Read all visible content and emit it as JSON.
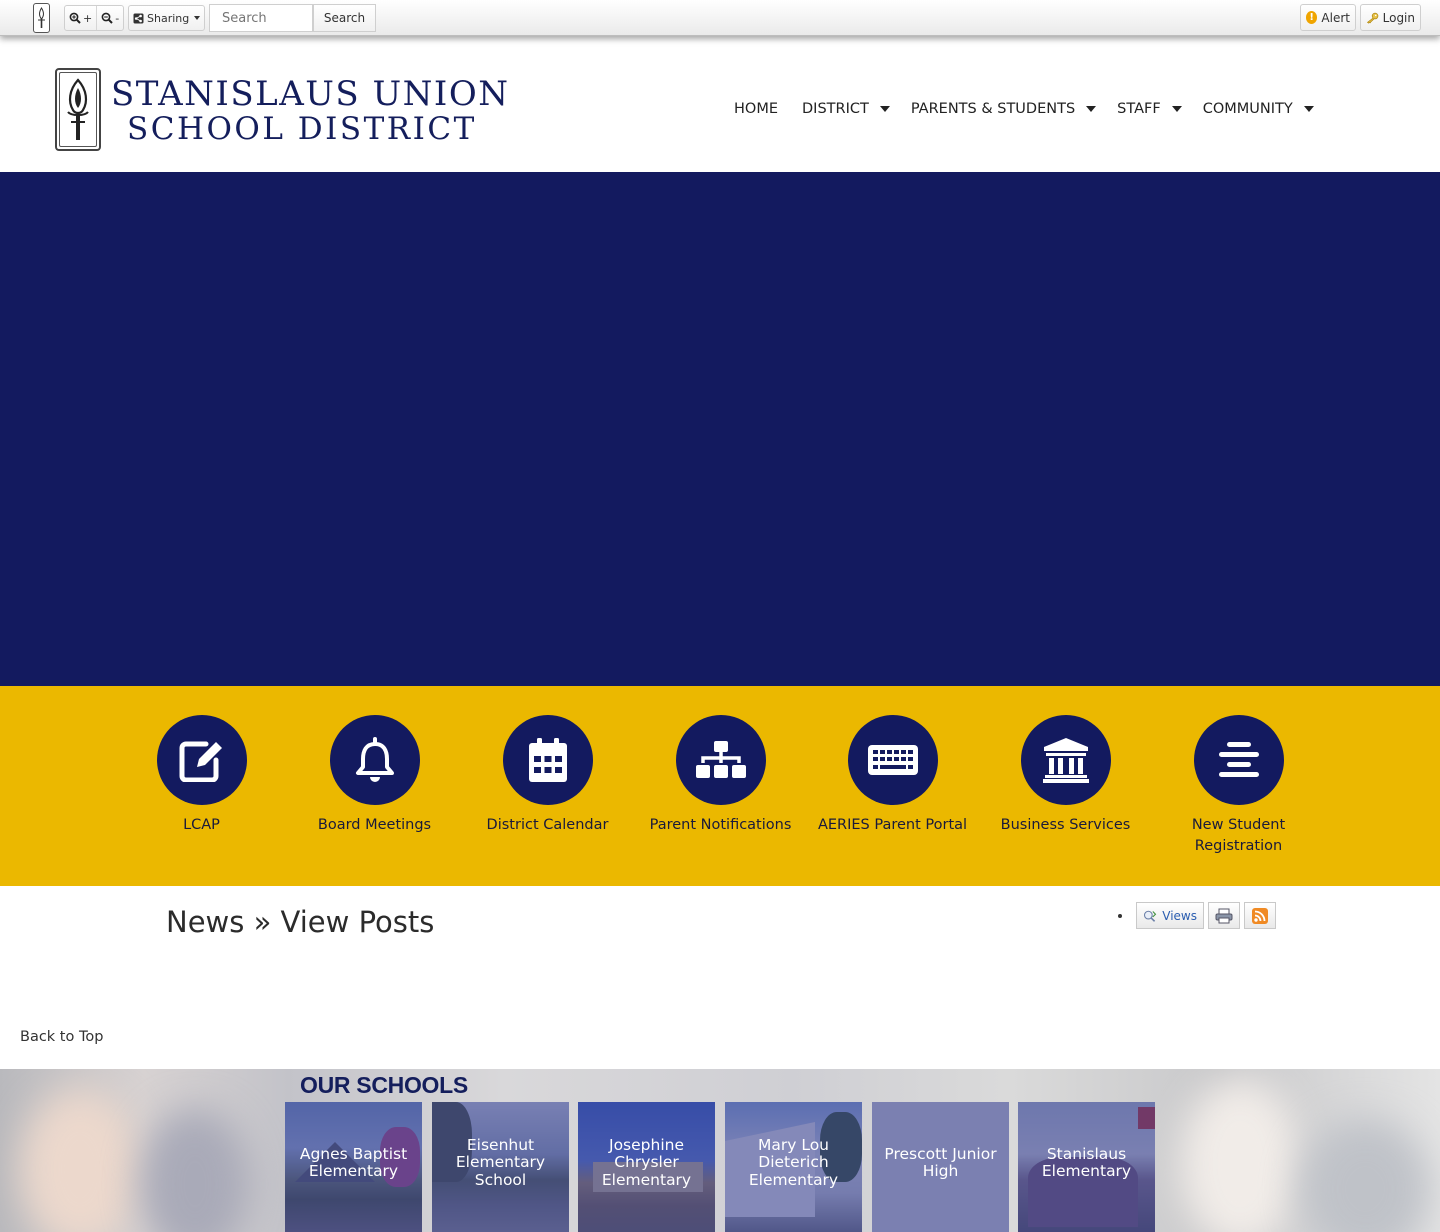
{
  "toolbar": {
    "zoom_in_label": "+",
    "zoom_out_label": "-",
    "sharing_label": "Sharing",
    "search_placeholder": "Search",
    "search_button": "Search",
    "alert_label": "Alert",
    "login_label": "Login"
  },
  "header": {
    "logo_line1": "STANISLAUS UNION",
    "logo_line2": "SCHOOL DISTRICT",
    "nav": [
      {
        "label": "HOME",
        "dropdown": false
      },
      {
        "label": "DISTRICT",
        "dropdown": true
      },
      {
        "label": "PARENTS & STUDENTS",
        "dropdown": true
      },
      {
        "label": "STAFF",
        "dropdown": true
      },
      {
        "label": "COMMUNITY",
        "dropdown": true
      }
    ]
  },
  "colors": {
    "navy": "#131a5f",
    "gold": "#ebb800",
    "logo_text": "#141e5c"
  },
  "quick_links": [
    {
      "label": "LCAP",
      "icon": "edit-icon"
    },
    {
      "label": "Board Meetings",
      "icon": "bell-icon"
    },
    {
      "label": "District Calendar",
      "icon": "calendar-icon"
    },
    {
      "label": "Parent Notifications",
      "icon": "sitemap-icon"
    },
    {
      "label": "AERIES Parent Portal",
      "icon": "keyboard-icon"
    },
    {
      "label": "Business Services",
      "icon": "institution-icon"
    },
    {
      "label": "New Student Registration",
      "icon": "align-center-icon"
    }
  ],
  "content": {
    "page_title": "News » View Posts",
    "views_label": "Views",
    "back_to_top": "Back to Top"
  },
  "schools": {
    "title": "OUR SCHOOLS",
    "items": [
      {
        "name": "Agnes Baptist Elementary"
      },
      {
        "name": "Eisenhut Elementary School"
      },
      {
        "name": "Josephine Chrysler Elementary"
      },
      {
        "name": "Mary Lou Dieterich Elementary"
      },
      {
        "name": "Prescott Junior High"
      },
      {
        "name": "Stanislaus Elementary"
      }
    ]
  }
}
